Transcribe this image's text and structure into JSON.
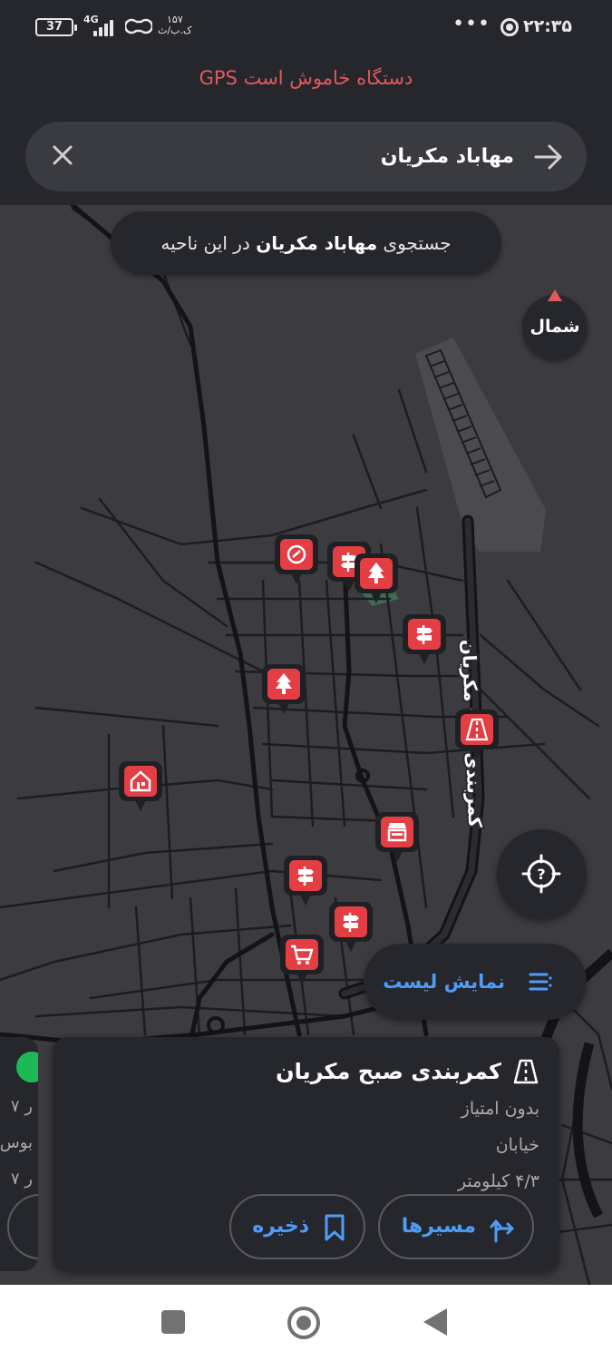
{
  "status_bar": {
    "battery": "37",
    "network": "4G",
    "speed": "۱۵۷\nک.ب/ث",
    "clock": "۲۲:۳۵",
    "more": "•••"
  },
  "gps_warning": "GPS دستگاه خاموش است",
  "search": {
    "value": "مهاباد مکریان"
  },
  "search_area_chip": {
    "prefix": "جستجوی",
    "query": "مهاباد مکریان",
    "suffix": "در این ناحیه"
  },
  "compass": {
    "label": "شمال"
  },
  "map": {
    "road_label": "کمربندی صبح مکریان",
    "pins": [
      {
        "icon": "gas-icon"
      },
      {
        "icon": "sign-icon"
      },
      {
        "icon": "tree-icon"
      },
      {
        "icon": "sign-icon"
      },
      {
        "icon": "tree-icon"
      },
      {
        "icon": "home-icon"
      },
      {
        "icon": "road-icon"
      },
      {
        "icon": "shop-icon"
      },
      {
        "icon": "sign-icon"
      },
      {
        "icon": "sign-icon"
      },
      {
        "icon": "cart-icon"
      }
    ]
  },
  "show_list": {
    "label": "نمایش لیست"
  },
  "result_card": {
    "title": "کمربندی صبح مکریان",
    "rating": "بدون امتیاز",
    "category": "خیابان",
    "distance": "۴/۳ کیلومتر",
    "routes_label": "مسیرها",
    "save_label": "ذخیره"
  },
  "prev_card": {
    "line1": "۷ ر",
    "line2": "بوس",
    "line3": "۷ ر"
  },
  "colors": {
    "accent": "#4f9cf7",
    "warning": "#e5575b",
    "pin": "#e23e44",
    "panel": "#26272c",
    "map": "#3b3b40"
  }
}
